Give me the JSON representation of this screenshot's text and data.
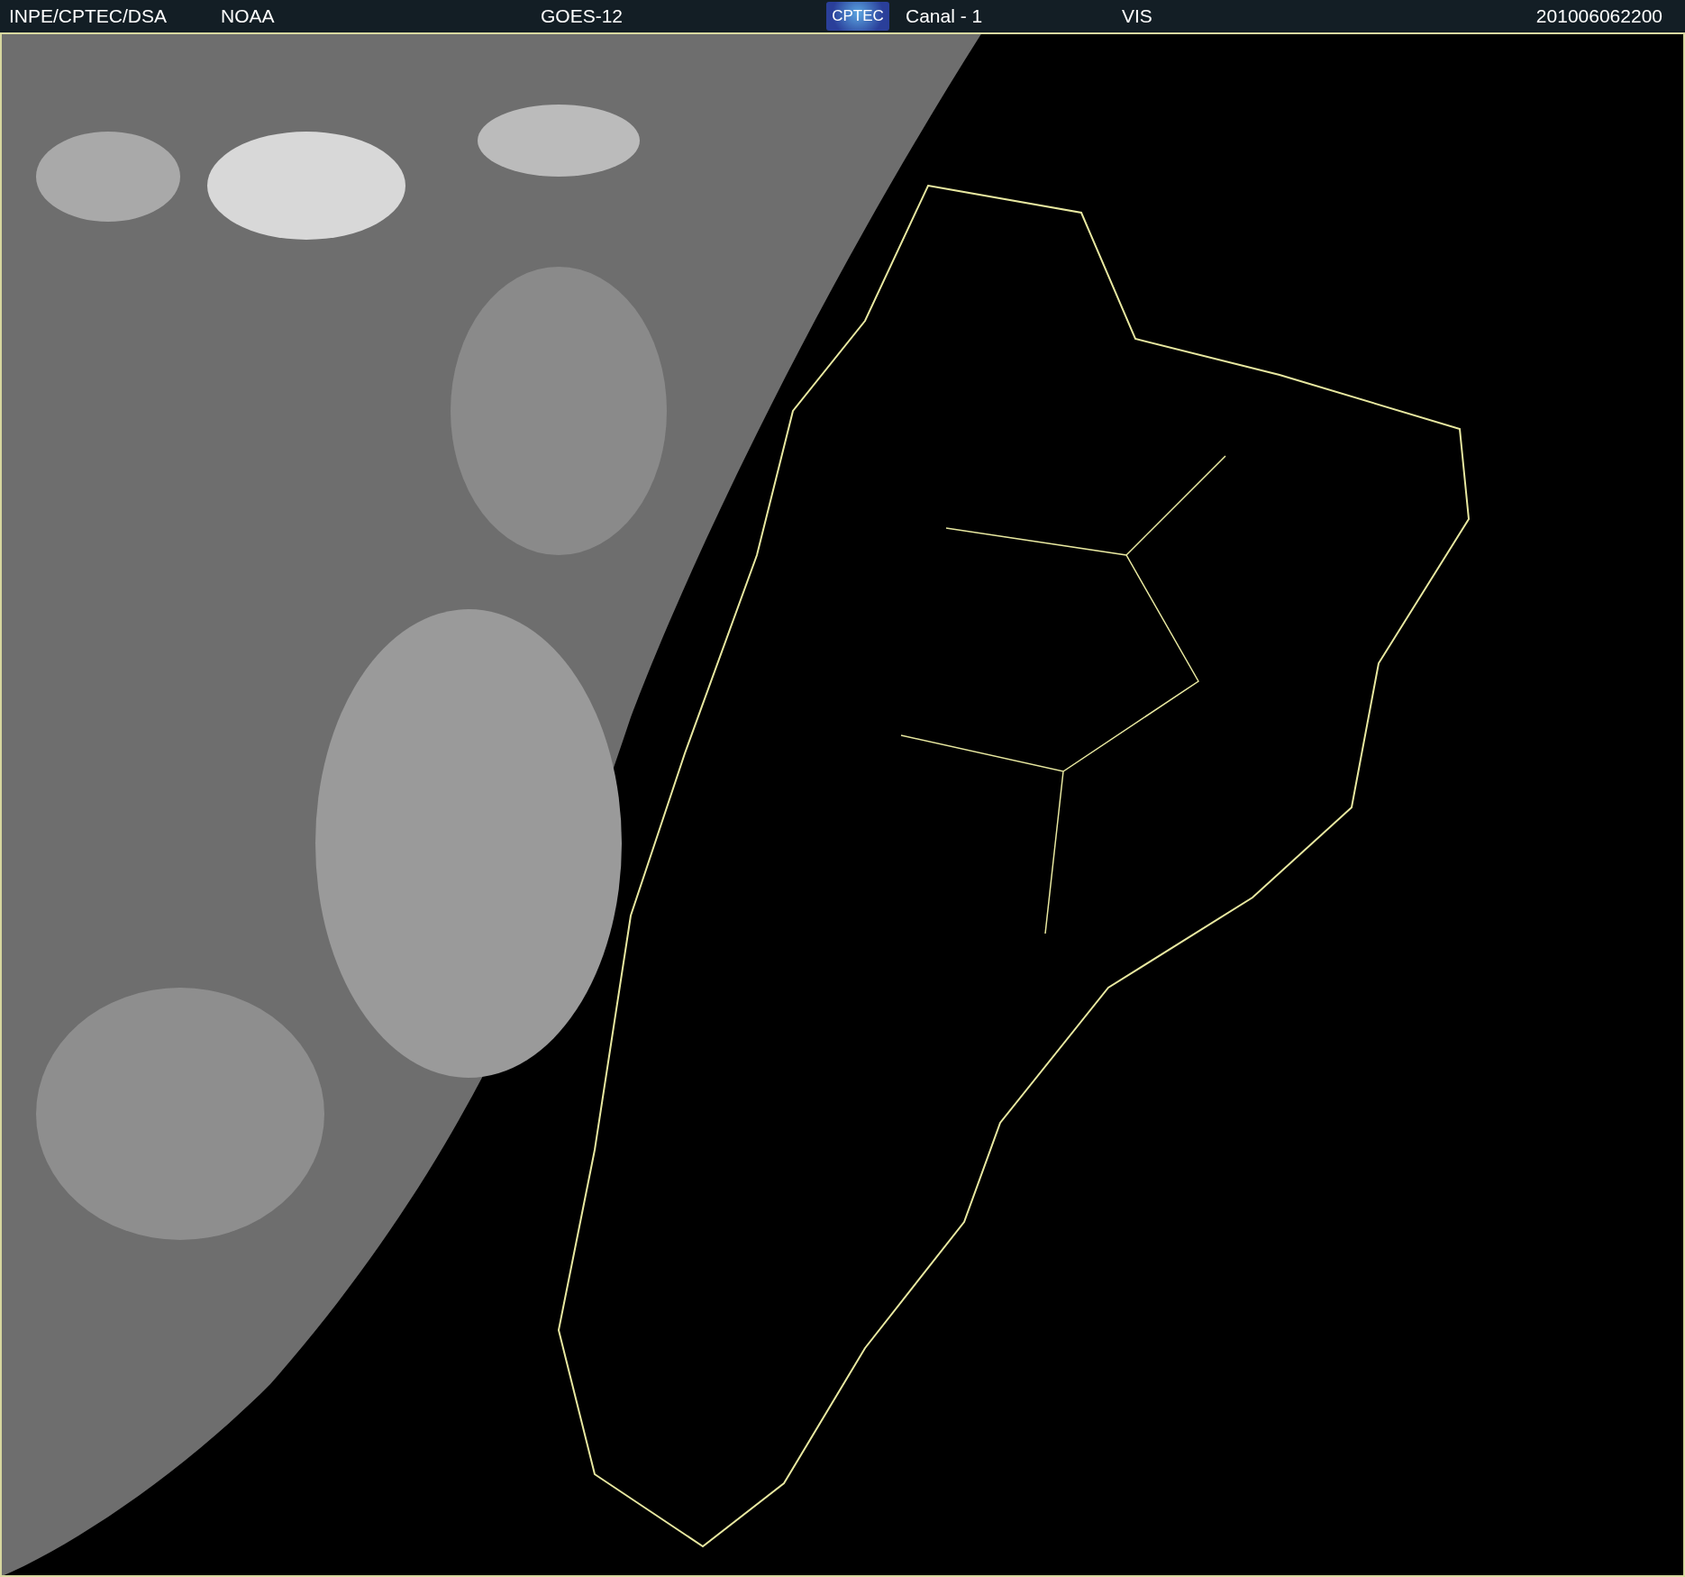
{
  "header": {
    "source": "INPE/CPTEC/DSA",
    "agency": "NOAA",
    "satellite": "GOES-12",
    "logo_text": "CPTEC",
    "channel": "Canal - 1",
    "band": "VIS",
    "timestamp": "201006062200"
  }
}
